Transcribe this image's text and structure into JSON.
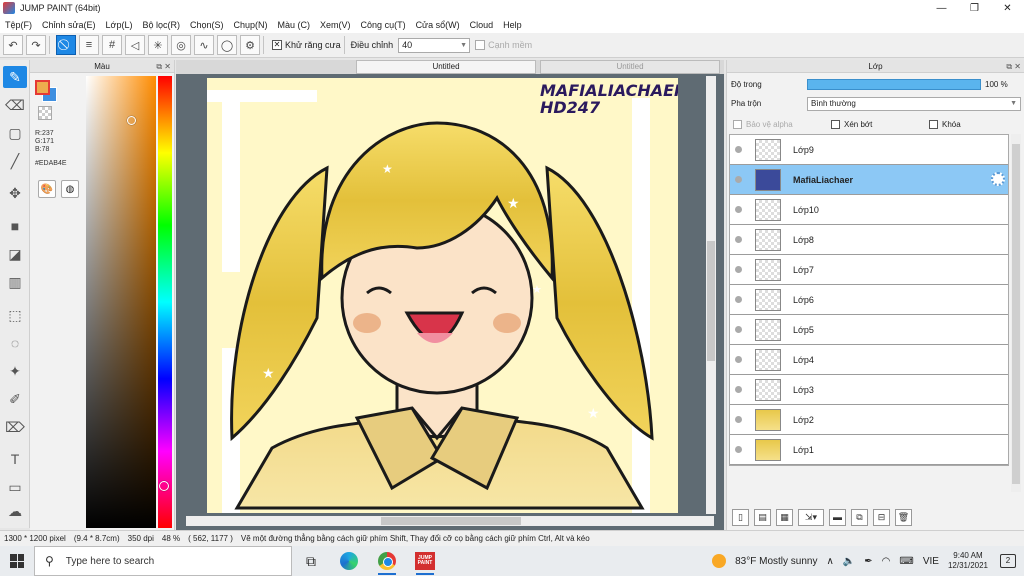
{
  "window": {
    "title": "JUMP PAINT (64bit)",
    "controls": {
      "minimize": "—",
      "restore": "❐",
      "close": "✕"
    }
  },
  "menu": [
    "Tệp(F)",
    "Chỉnh sửa(E)",
    "Lớp(L)",
    "Bộ lọc(R)",
    "Chọn(S)",
    "Chụp(N)",
    "Màu (C)",
    "Xem(V)",
    "Công cụ(T)",
    "Cửa sổ(W)",
    "Cloud",
    "Help"
  ],
  "toolbar": {
    "antialias_checked": true,
    "antialias_label": "Khử răng cưa",
    "adjust_label": "Điều chỉnh",
    "adjust_value": "40",
    "smooth_label": "Cạnh mềm",
    "smooth_checked": false
  },
  "color_panel": {
    "title": "Màu",
    "r": "R:237",
    "g": "G:171",
    "b": "B:78",
    "hex": "#EDAB4E",
    "fg_color": "#EDAB4E"
  },
  "document": {
    "tabs": [
      {
        "label": "Untitled",
        "active": true
      },
      {
        "label": "Untitled",
        "active": false
      }
    ],
    "watermark_line1": "MAFIALIACHAER",
    "watermark_line2": "HD247"
  },
  "layer_panel": {
    "title": "Lớp",
    "opacity_label": "Độ trong",
    "opacity_value": "100 %",
    "opacity": 1.0,
    "blend_label": "Pha trộn",
    "blend_value": "Bình thường",
    "protect_alpha_label": "Bảo vệ alpha",
    "clip_label": "Xén bớt",
    "lock_label": "Khóa",
    "layers": [
      {
        "name": "Lớp9",
        "selected": false
      },
      {
        "name": "MafiaLiachaer",
        "selected": true
      },
      {
        "name": "Lớp10",
        "selected": false
      },
      {
        "name": "Lớp8",
        "selected": false
      },
      {
        "name": "Lớp7",
        "selected": false
      },
      {
        "name": "Lớp6",
        "selected": false
      },
      {
        "name": "Lớp5",
        "selected": false
      },
      {
        "name": "Lớp4",
        "selected": false
      },
      {
        "name": "Lớp3",
        "selected": false
      },
      {
        "name": "Lớp2",
        "selected": false
      },
      {
        "name": "Lớp1",
        "selected": false
      }
    ]
  },
  "status": {
    "size": "1300 * 1200 pixel",
    "dimensions": "(9.4 * 8.7cm)",
    "dpi": "350 dpi",
    "zoom": "48 %",
    "coords": "( 562, 1177 )",
    "hint": "Vẽ một đường thẳng bằng cách giữ phím Shift, Thay đổi cỡ cọ bằng cách giữ phím Ctrl, Alt và kéo"
  },
  "taskbar": {
    "search_placeholder": "Type here to search",
    "jp_icon_label": "JUMP PAINT",
    "weather": "83°F  Mostly sunny",
    "language": "VIE",
    "time": "9:40 AM",
    "date": "12/31/2021",
    "notifications": "2"
  }
}
